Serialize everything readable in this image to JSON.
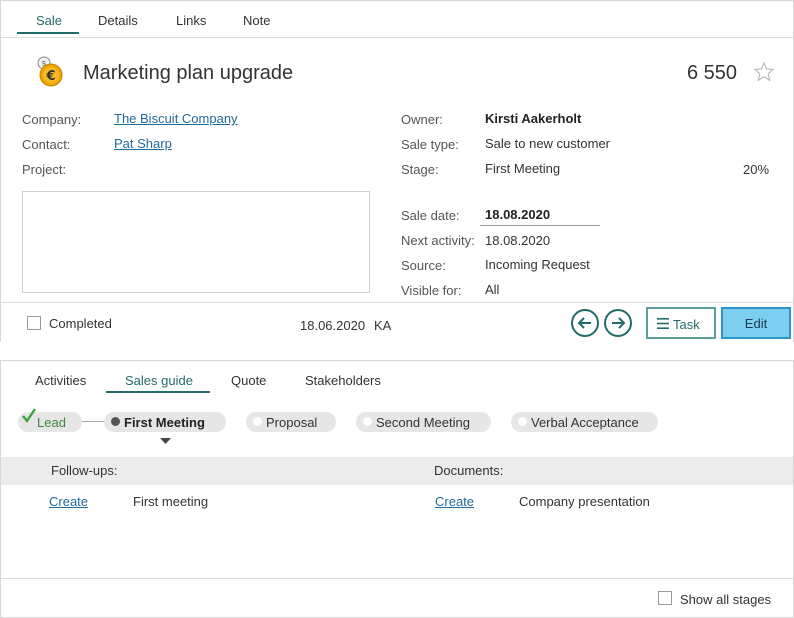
{
  "top_tabs": [
    "Sale",
    "Details",
    "Links",
    "Note"
  ],
  "sale": {
    "title": "Marketing plan upgrade",
    "amount": "6 550",
    "icon": "money-bag-euro-icon"
  },
  "left_fields": {
    "company_label": "Company:",
    "company_value": "The Biscuit Company",
    "contact_label": "Contact:",
    "contact_value": "Pat Sharp",
    "project_label": "Project:"
  },
  "right_fields": {
    "owner_label": "Owner:",
    "owner_value": "Kirsti Aakerholt",
    "sale_type_label": "Sale type:",
    "sale_type_value": "Sale to new customer",
    "stage_label": "Stage:",
    "stage_value": "First Meeting",
    "stage_percent": "20%",
    "sale_date_label": "Sale date:",
    "sale_date_value": "18.08.2020",
    "next_activity_label": "Next activity:",
    "next_activity_value": "18.08.2020",
    "source_label": "Source:",
    "source_value": "Incoming Request",
    "visible_for_label": "Visible for:",
    "visible_for_value": "All"
  },
  "footer": {
    "completed_label": "Completed",
    "completed_checked": false,
    "date": "18.06.2020",
    "initials": "KA",
    "task_label": "Task",
    "edit_label": "Edit"
  },
  "bottom_tabs": [
    "Activities",
    "Sales guide",
    "Quote",
    "Stakeholders"
  ],
  "stages": [
    "Lead",
    "First Meeting",
    "Proposal",
    "Second Meeting",
    "Verbal Acceptance"
  ],
  "guide": {
    "followups_label": "Follow-ups:",
    "documents_label": "Documents:",
    "followup_create": "Create",
    "followup_item": "First meeting",
    "document_create": "Create",
    "document_item": "Company presentation"
  },
  "show_all_stages_label": "Show all stages",
  "colors": {
    "accent": "#216b6b",
    "link": "#216b9b",
    "edit_button": "#7ccff1",
    "lead_check": "#3aa63a"
  }
}
